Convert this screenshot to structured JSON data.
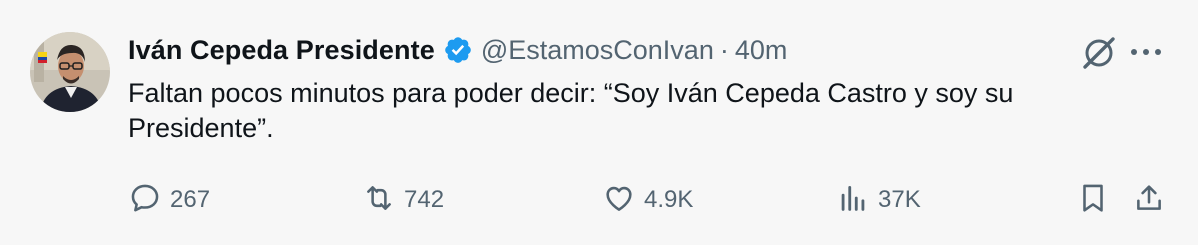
{
  "tweet": {
    "author_name": "Iván Cepeda Presidente",
    "handle": "@EstamosConIvan",
    "separator": "·",
    "time": "40m",
    "text": "Faltan pocos minutos para poder decir: “Soy Iván Cepeda Castro y soy su Presidente”."
  },
  "actions": {
    "replies": "267",
    "reposts": "742",
    "likes": "4.9K",
    "views": "37K"
  },
  "colors": {
    "background": "#f7f7f7",
    "text": "#0f1419",
    "secondary": "#536471",
    "verified": "#1d9bf0"
  },
  "icons": [
    "verified-badge-icon",
    "grok-icon",
    "more-icon",
    "reply-icon",
    "repost-icon",
    "like-icon",
    "views-icon",
    "bookmark-icon",
    "share-icon"
  ]
}
